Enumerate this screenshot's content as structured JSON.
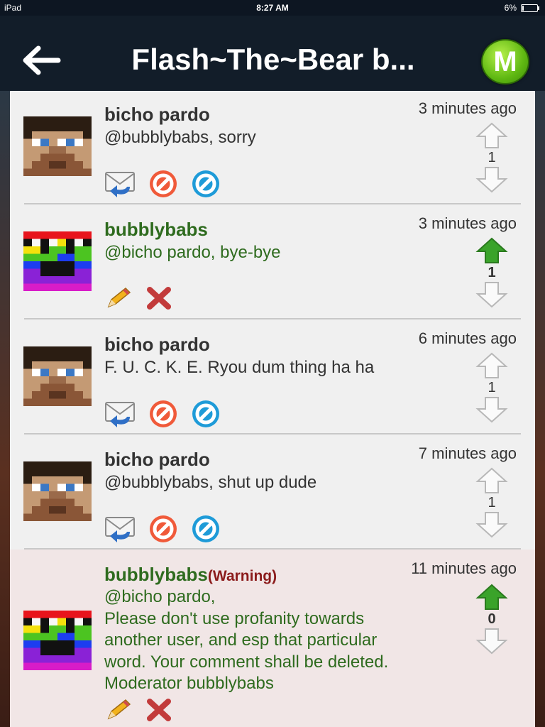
{
  "status_bar": {
    "device": "iPad",
    "time": "8:27 AM",
    "battery": "6%"
  },
  "nav": {
    "title": "Flash~The~Bear b...",
    "logo_letter": "M"
  },
  "comments": [
    {
      "user": "bicho pardo",
      "warning": "",
      "text": "@bubblybabs, sorry",
      "time": "3 minutes ago",
      "votes": "1",
      "upvoted": false,
      "is_mod": false
    },
    {
      "user": "bubblybabs",
      "warning": "",
      "text": "@bicho pardo, bye-bye",
      "time": "3 minutes ago",
      "votes": "1",
      "upvoted": true,
      "is_mod": true
    },
    {
      "user": "bicho pardo",
      "warning": "",
      "text": "F.  U.  C. K. E. Ryou dum thing ha ha",
      "time": "6 minutes ago",
      "votes": "1",
      "upvoted": false,
      "is_mod": false
    },
    {
      "user": "bicho pardo",
      "warning": "",
      "text": "@bubblybabs, shut up dude",
      "time": "7 minutes ago",
      "votes": "1",
      "upvoted": false,
      "is_mod": false
    },
    {
      "user": "bubblybabs",
      "warning": "(Warning)",
      "text_lines": [
        "@bicho pardo,",
        "Please don't use profanity towards",
        "another user, and esp that particular",
        "word. Your comment shall be deleted.",
        "Moderator bubblybabs"
      ],
      "time": "11 minutes ago",
      "votes": "0",
      "upvoted": true,
      "is_mod": true
    }
  ],
  "colors": {
    "mod_green": "#2e6b1e",
    "warning_red": "#8b1b1b",
    "upvote_green": "#3aa32a"
  },
  "icons": [
    "back-arrow-icon",
    "m-logo-icon",
    "reply-icon",
    "block-icon",
    "ignore-icon",
    "edit-pencil-icon",
    "delete-x-icon",
    "upvote-arrow-icon",
    "downvote-arrow-icon"
  ]
}
